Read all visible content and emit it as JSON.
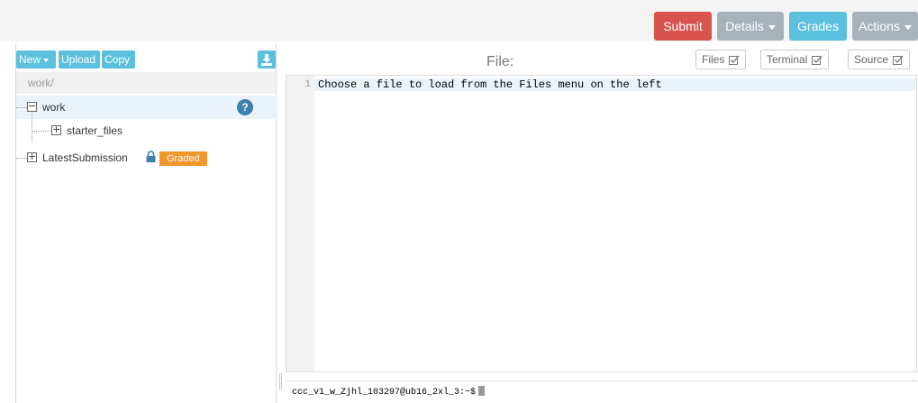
{
  "toolbar": {
    "submit_label": "Submit",
    "details_label": "Details",
    "grades_label": "Grades",
    "actions_label": "Actions"
  },
  "file_panel": {
    "new_label": "New",
    "upload_label": "Upload",
    "copy_label": "Copy",
    "download_icon": "download-icon",
    "path": "work/",
    "tree": [
      {
        "label": "work",
        "expanded": true,
        "selected": true,
        "badge": "?"
      },
      {
        "label": "starter_files",
        "expanded": false
      },
      {
        "label": "LatestSubmission",
        "expanded": false,
        "locked": true,
        "badge": "Graded"
      }
    ]
  },
  "editor": {
    "title": "File:",
    "toggles": [
      {
        "label": "Files",
        "checked": true
      },
      {
        "label": "Terminal",
        "checked": true
      },
      {
        "label": "Source",
        "checked": true
      }
    ],
    "lines": [
      {
        "number": "1",
        "text": "Choose a file to load from the Files menu on the left"
      }
    ]
  },
  "terminal": {
    "prompt": "ccc_v1_w_Zjhl_103297@ub16_2xl_3:~$"
  },
  "colors": {
    "submit": "#d9534f",
    "grades": "#5bc0de",
    "muted_button": "#a8b2bd",
    "graded_badge": "#f0962b",
    "help_badge": "#3b7fae"
  }
}
